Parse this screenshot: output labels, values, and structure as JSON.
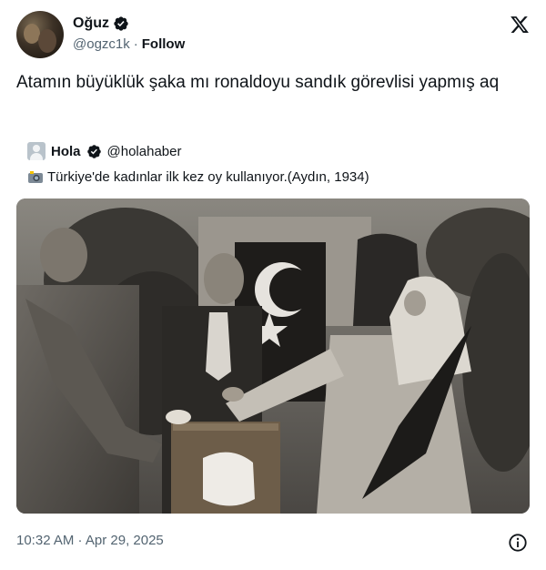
{
  "header": {
    "name": "Oğuz",
    "handle": "@ogzc1k",
    "separator": "·",
    "follow_label": "Follow"
  },
  "tweet": {
    "text": "Atamın büyüklük şaka mı ronaldoyu sandık görevlisi yapmış aq"
  },
  "quote": {
    "name": "Hola",
    "handle": "@holahaber",
    "text": "Türkiye'de kadınlar ilk kez oy kullanıyor.(Aydın, 1934)",
    "text_icon": "camera-flash-icon"
  },
  "footer": {
    "timestamp": "10:32 AM · Apr 29, 2025"
  },
  "colors": {
    "verified": "#0f1419",
    "secondary_text": "#536471",
    "primary_text": "#0f1419"
  }
}
